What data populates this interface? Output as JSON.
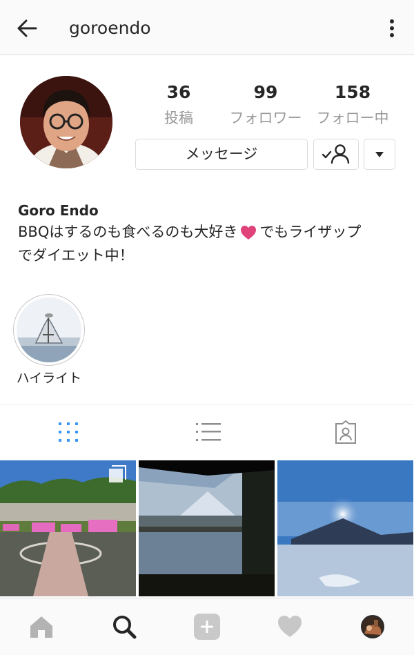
{
  "header": {
    "username": "goroendo"
  },
  "profile": {
    "stats": [
      {
        "value": "36",
        "label": "投稿"
      },
      {
        "value": "99",
        "label": "フォロワー"
      },
      {
        "value": "158",
        "label": "フォロー中"
      }
    ],
    "message_button": "メッセージ",
    "name": "Goro Endo",
    "bio_line1_a": "BBQはするのも食べるのも大好き",
    "bio_line1_b": "でもライザップ",
    "bio_line2": "でダイエット中！"
  },
  "highlights": [
    {
      "label": "ハイライト"
    }
  ],
  "tabs": [
    "grid-icon",
    "list-icon",
    "tagged-icon"
  ],
  "bottom_nav": [
    "home-icon",
    "search-icon",
    "add-icon",
    "heart-icon",
    "profile-icon"
  ],
  "colors": {
    "accent": "#3897f0",
    "heart": "#e0427a",
    "border": "#dbdbdb"
  }
}
